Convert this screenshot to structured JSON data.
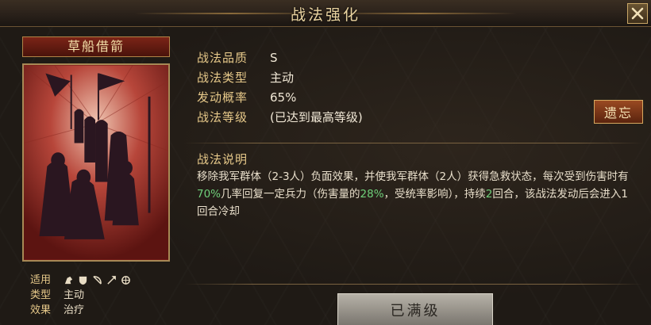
{
  "window": {
    "title": "战法强化",
    "close_label": "×"
  },
  "card": {
    "name": "草船借箭"
  },
  "meta": [
    {
      "key": "适用",
      "value": ""
    },
    {
      "key": "类型",
      "value": "主动"
    },
    {
      "key": "效果",
      "value": "治疗"
    }
  ],
  "meta_icons": [
    "cavalry-icon",
    "shield-icon",
    "bow-icon",
    "spear-icon",
    "wheel-icon"
  ],
  "props": [
    {
      "key": "战法品质",
      "value": "S"
    },
    {
      "key": "战法类型",
      "value": "主动"
    },
    {
      "key": "发动概率",
      "value": "65%"
    },
    {
      "key": "战法等级",
      "value": "(已达到最高等级)"
    }
  ],
  "forget_button": "遗忘",
  "description": {
    "title": "战法说明",
    "part1": "移除我军群体（2-3人）负面效果，并使我军群体（2人）获得急救状态，每次受到伤害时有",
    "hl1": "70%",
    "part2": "几率回复一定兵力（伤害量的",
    "hl2": "28%",
    "part3": "，受统率影响），持续",
    "hl3": "2",
    "part4": "回合，该战法发动后会进入1回合冷却"
  },
  "max_button": "已满级",
  "colors": {
    "gold": "#e7c98a",
    "highlight_green": "#6fd07a",
    "card_red": "#7a1c18",
    "button_brown": "#9a4a22"
  }
}
